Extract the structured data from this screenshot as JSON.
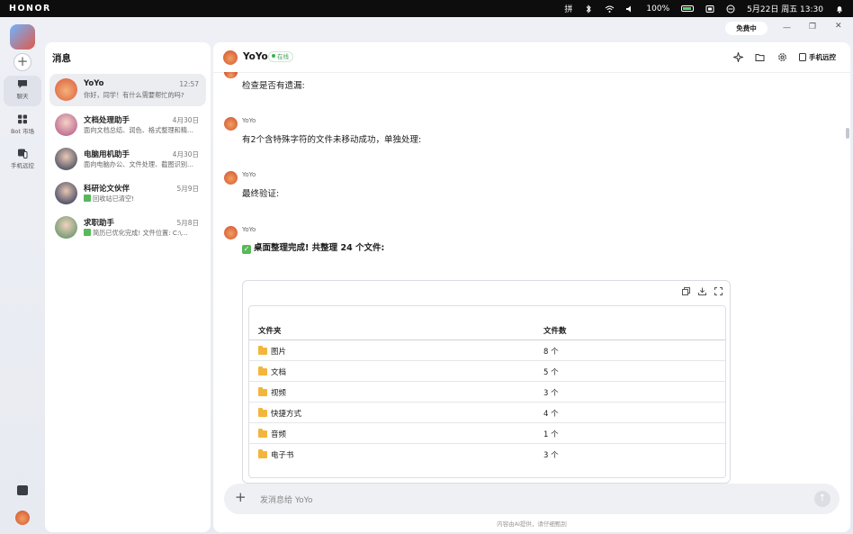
{
  "statusbar": {
    "brand": "HONOR",
    "ime": "拼",
    "battery": "100%",
    "datetime": "5月22日 周五 13:30"
  },
  "rail": {
    "items": [
      {
        "label": "聊天",
        "icon": "chat-icon"
      },
      {
        "label": "Bot 市场",
        "icon": "grid-icon"
      },
      {
        "label": "手机远控",
        "icon": "phone-remote-icon"
      }
    ]
  },
  "window": {
    "free_label": "免费中"
  },
  "sidebar": {
    "title": "消息",
    "conversations": [
      {
        "name": "YoYo",
        "date": "12:57",
        "preview": "你好，同学！有什么需要帮忙的吗?"
      },
      {
        "name": "文档处理助手",
        "date": "4月30日",
        "preview": "面向文档总结、润色、格式整理和精..."
      },
      {
        "name": "电脑用机助手",
        "date": "4月30日",
        "preview": "面向电脑办公、文件处理、截图识别..."
      },
      {
        "name": "科研论文伙伴",
        "date": "5月9日",
        "preview": "回收站已清空!"
      },
      {
        "name": "求职助手",
        "date": "5月8日",
        "preview": "简历已优化完成! 文件位置: C:\\..."
      }
    ]
  },
  "chat": {
    "title": "YoYo",
    "status": "在线",
    "remote_label": "手机远控",
    "messages": [
      {
        "sender": "",
        "text": "检查是否有遗漏:"
      },
      {
        "sender": "YoYo",
        "text": "有2个含特殊字符的文件未移动成功，单独处理:"
      },
      {
        "sender": "YoYo",
        "text": "最终验证:"
      },
      {
        "sender": "YoYo",
        "text_bold": "桌面整理完成!",
        "text_rest": "共整理 24 个文件:"
      }
    ],
    "table": {
      "headers": [
        "文件夹",
        "文件数"
      ],
      "rows": [
        {
          "folder": "图片",
          "count": "8 个"
        },
        {
          "folder": "文档",
          "count": "5 个"
        },
        {
          "folder": "视频",
          "count": "3 个"
        },
        {
          "folder": "快捷方式",
          "count": "4 个"
        },
        {
          "folder": "音频",
          "count": "1 个"
        },
        {
          "folder": "电子书",
          "count": "3 个"
        }
      ]
    },
    "input_placeholder": "发消息给 YoYo",
    "footnote": "内容由AI提供，请仔细甄别"
  },
  "colors": {
    "accent_green": "#58b85b",
    "folder_yellow": "#f2b63d",
    "online_green": "#37b24d"
  }
}
